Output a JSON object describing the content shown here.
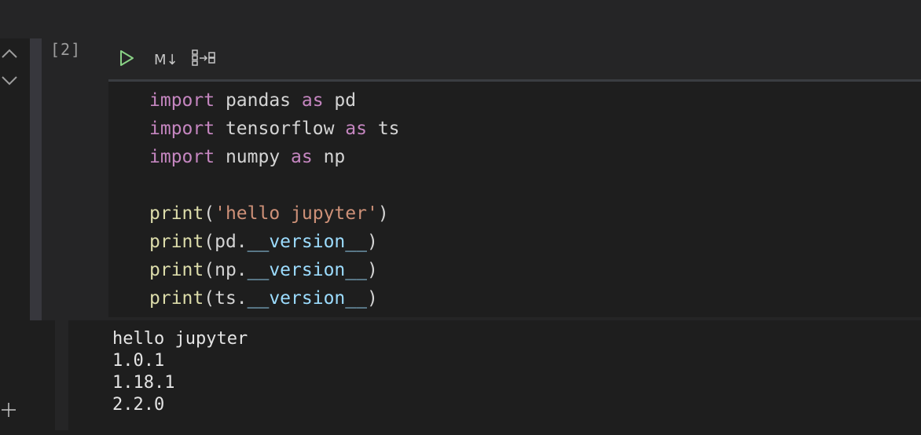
{
  "cell": {
    "execution_count": "[2]",
    "toolbar": {
      "run_icon": "play-icon",
      "markdown_label": "M↓",
      "split_icon": "split-cell-icon"
    },
    "code_lines": [
      [
        {
          "t": "import",
          "c": "kw"
        },
        {
          "t": " pandas ",
          "c": ""
        },
        {
          "t": "as",
          "c": "kw"
        },
        {
          "t": " pd",
          "c": ""
        }
      ],
      [
        {
          "t": "import",
          "c": "kw"
        },
        {
          "t": " tensorflow ",
          "c": ""
        },
        {
          "t": "as",
          "c": "kw"
        },
        {
          "t": " ts",
          "c": ""
        }
      ],
      [
        {
          "t": "import",
          "c": "kw"
        },
        {
          "t": " numpy ",
          "c": ""
        },
        {
          "t": "as",
          "c": "kw"
        },
        {
          "t": " np",
          "c": ""
        }
      ],
      [],
      [
        {
          "t": "print",
          "c": "fn"
        },
        {
          "t": "(",
          "c": ""
        },
        {
          "t": "'hello jupyter'",
          "c": "str"
        },
        {
          "t": ")",
          "c": ""
        }
      ],
      [
        {
          "t": "print",
          "c": "fn"
        },
        {
          "t": "(pd.",
          "c": ""
        },
        {
          "t": "__version__",
          "c": "attr"
        },
        {
          "t": ")",
          "c": ""
        }
      ],
      [
        {
          "t": "print",
          "c": "fn"
        },
        {
          "t": "(np.",
          "c": ""
        },
        {
          "t": "__version__",
          "c": "attr"
        },
        {
          "t": ")",
          "c": ""
        }
      ],
      [
        {
          "t": "print",
          "c": "fn"
        },
        {
          "t": "(ts.",
          "c": ""
        },
        {
          "t": "__version__",
          "c": "attr"
        },
        {
          "t": ")",
          "c": ""
        }
      ]
    ],
    "output_lines": [
      "hello jupyter",
      "1.0.1",
      "1.18.1",
      "2.2.0"
    ]
  },
  "colors": {
    "keyword": "#c586c0",
    "function": "#dcdcaa",
    "string": "#ce9178",
    "attribute": "#9cdcfe",
    "run_icon": "#89d185"
  },
  "nav": {
    "up_icon": "chevron-up-icon",
    "down_icon": "chevron-down-icon",
    "add_icon": "plus-icon"
  }
}
